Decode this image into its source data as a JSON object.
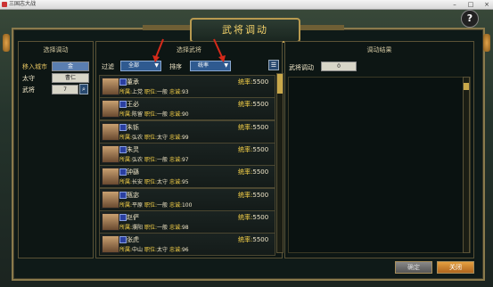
{
  "window": {
    "title": "三国志大战"
  },
  "dialog": {
    "title": "武将调动"
  },
  "left": {
    "title": "选择调动",
    "move_city_label": "移入城市",
    "move_city_value": "金",
    "governor_label": "太守",
    "governor_value": "曹仁",
    "general_label": "武将",
    "general_count": "7"
  },
  "middle": {
    "title": "选择武将",
    "filter_label": "过滤",
    "filter_value": "全部",
    "sort_label": "排序",
    "sort_value": "统率",
    "rows": [
      {
        "name": "董承",
        "lead_label": "统率:",
        "lead": "5500",
        "loc_label": "所属:",
        "loc": "上党",
        "pos_label": "职位:",
        "pos": "一般",
        "loy_label": "忠诚:",
        "loy": "93"
      },
      {
        "name": "王必",
        "lead_label": "统率:",
        "lead": "5500",
        "loc_label": "所属:",
        "loc": "陈留",
        "pos_label": "职位:",
        "pos": "一般",
        "loy_label": "忠诚:",
        "loy": "90"
      },
      {
        "name": "朱铄",
        "lead_label": "统率:",
        "lead": "5500",
        "loc_label": "所属:",
        "loc": "弘农",
        "pos_label": "职位:",
        "pos": "太守",
        "loy_label": "忠诚:",
        "loy": "99"
      },
      {
        "name": "朱灵",
        "lead_label": "统率:",
        "lead": "5500",
        "loc_label": "所属:",
        "loc": "弘农",
        "pos_label": "职位:",
        "pos": "一般",
        "loy_label": "忠诚:",
        "loy": "97"
      },
      {
        "name": "钟繇",
        "lead_label": "统率:",
        "lead": "5500",
        "loc_label": "所属:",
        "loc": "长安",
        "pos_label": "职位:",
        "pos": "太守",
        "loy_label": "忠诚:",
        "loy": "95"
      },
      {
        "name": "甄宓",
        "lead_label": "统率:",
        "lead": "5500",
        "loc_label": "所属:",
        "loc": "平原",
        "pos_label": "职位:",
        "pos": "一般",
        "loy_label": "忠诚:",
        "loy": "100"
      },
      {
        "name": "赵俨",
        "lead_label": "统率:",
        "lead": "5500",
        "loc_label": "所属:",
        "loc": "濮阳",
        "pos_label": "职位:",
        "pos": "一般",
        "loy_label": "忠诚:",
        "loy": "98"
      },
      {
        "name": "张虎",
        "lead_label": "统率:",
        "lead": "5500",
        "loc_label": "所属:",
        "loc": "中山",
        "pos_label": "职位:",
        "pos": "太守",
        "loy_label": "忠诚:",
        "loy": "96"
      }
    ]
  },
  "right": {
    "title": "调动结果",
    "transfer_label": "武将调动",
    "transfer_count": "0"
  },
  "buttons": {
    "confirm": "确定",
    "cancel": "关闭"
  },
  "colors": {
    "accent": "#f4d26a",
    "frame": "#8a7a4c",
    "select": "#2f5a90"
  }
}
